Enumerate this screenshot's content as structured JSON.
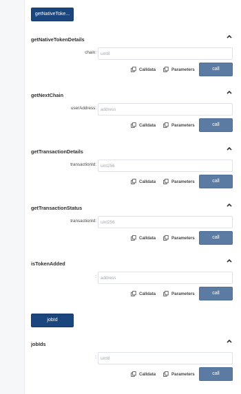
{
  "top_button": {
    "label": "getNativeToke..."
  },
  "functions": [
    {
      "name": "getNativeTokenDetails",
      "param_label": "chain:",
      "param_placeholder": "uint8"
    },
    {
      "name": "getNextChain",
      "param_label": "userAddress:",
      "param_placeholder": "address"
    },
    {
      "name": "getTransactionDetails",
      "param_label": "transactionId:",
      "param_placeholder": "uint256"
    },
    {
      "name": "getTransactionStatus",
      "param_label": "transactionId:",
      "param_placeholder": "uint256"
    },
    {
      "name": "isTokenAdded",
      "param_label": ":",
      "param_placeholder": "address"
    },
    {
      "name": "jobIds",
      "param_label": ":",
      "param_placeholder": "uint8"
    }
  ],
  "jobId_button": {
    "label": "jobId"
  },
  "actions": {
    "calldata": "Calldata",
    "parameters": "Parameters",
    "call": "call"
  },
  "icons": {
    "chevron": "chevron-up-icon",
    "copy": "copy-icon"
  },
  "colors": {
    "primary": "#1a467d",
    "call": "#5b7ba3"
  }
}
